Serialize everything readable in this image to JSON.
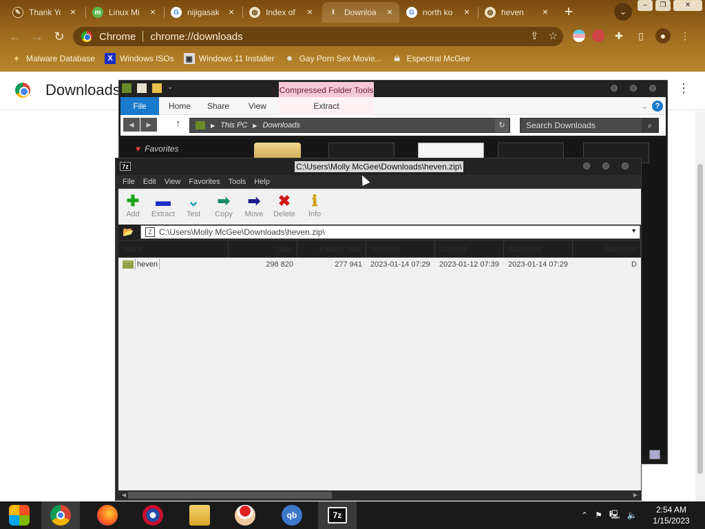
{
  "browser": {
    "tabs": [
      {
        "title": "Thank Yo",
        "icon": "thank-you-favicon"
      },
      {
        "title": "Linux Mi",
        "icon": "linux-mint-favicon"
      },
      {
        "title": "nijigasak",
        "icon": "google-favicon"
      },
      {
        "title": "Index of",
        "icon": "globe-favicon"
      },
      {
        "title": "Downloa",
        "icon": "download-favicon"
      },
      {
        "title": "north ko",
        "icon": "google-favicon"
      },
      {
        "title": "heven",
        "icon": "globe-favicon"
      }
    ],
    "new_tab": "+",
    "omnibox": {
      "site": "Chrome",
      "url": "chrome://downloads"
    },
    "bookmarks": [
      {
        "label": "Malware Database"
      },
      {
        "label": "Windows ISOs"
      },
      {
        "label": "Windows 11 Installer"
      },
      {
        "label": "Gay Porn Sex Movie..."
      },
      {
        "label": "Espectral McGee"
      }
    ],
    "page_title": "Downloads",
    "accent": "#9c6a1d"
  },
  "explorer": {
    "context_tab": "Compressed Folder Tools",
    "ribbon": {
      "file": "File",
      "home": "Home",
      "share": "Share",
      "view": "View",
      "extract": "Extract"
    },
    "path": {
      "root": "This PC",
      "folder": "Downloads"
    },
    "search_placeholder": "Search Downloads",
    "favorites": "Favorites"
  },
  "sevenzip": {
    "window_title": "C:\\Users\\Molly McGee\\Downloads\\heven.zip\\",
    "menu": [
      "File",
      "Edit",
      "View",
      "Favorites",
      "Tools",
      "Help"
    ],
    "toolbar": [
      {
        "label": "Add",
        "icon": "plus-icon",
        "color": "#1aa31a"
      },
      {
        "label": "Extract",
        "icon": "minus-icon",
        "color": "#1a2ec8"
      },
      {
        "label": "Test",
        "icon": "check-icon",
        "color": "#2aa3b8"
      },
      {
        "label": "Copy",
        "icon": "arrow-right-icon",
        "color": "#1a8a6a"
      },
      {
        "label": "Move",
        "icon": "arrow-right-icon",
        "color": "#1a1a8a"
      },
      {
        "label": "Delete",
        "icon": "x-icon",
        "color": "#d01818"
      },
      {
        "label": "Info",
        "icon": "info-icon",
        "color": "#d0a010"
      }
    ],
    "address": "C:\\Users\\Molly McGee\\Downloads\\heven.zip\\",
    "columns": [
      "Name",
      "Size",
      "Packed Size",
      "Modified",
      "Created",
      "Accessed",
      "Attributes"
    ],
    "rows": [
      {
        "name": "heven",
        "size": "298 820",
        "packed": "277 941",
        "modified": "2023-01-14 07:29",
        "created": "2023-01-12 07:39",
        "accessed": "2023-01-14 07:29",
        "attributes": "D"
      }
    ]
  },
  "taskbar": {
    "apps": [
      {
        "name": "Windows Start",
        "label": ""
      },
      {
        "name": "Chrome",
        "label": ""
      },
      {
        "name": "Firefox",
        "label": ""
      },
      {
        "name": "Obama",
        "label": ""
      },
      {
        "name": "File Explorer",
        "label": ""
      },
      {
        "name": "Santa",
        "label": ""
      },
      {
        "name": "qBittorrent",
        "label": "qb"
      },
      {
        "name": "7-Zip",
        "label": "7z"
      }
    ],
    "time": "2:54 AM",
    "date": "1/15/2023"
  }
}
